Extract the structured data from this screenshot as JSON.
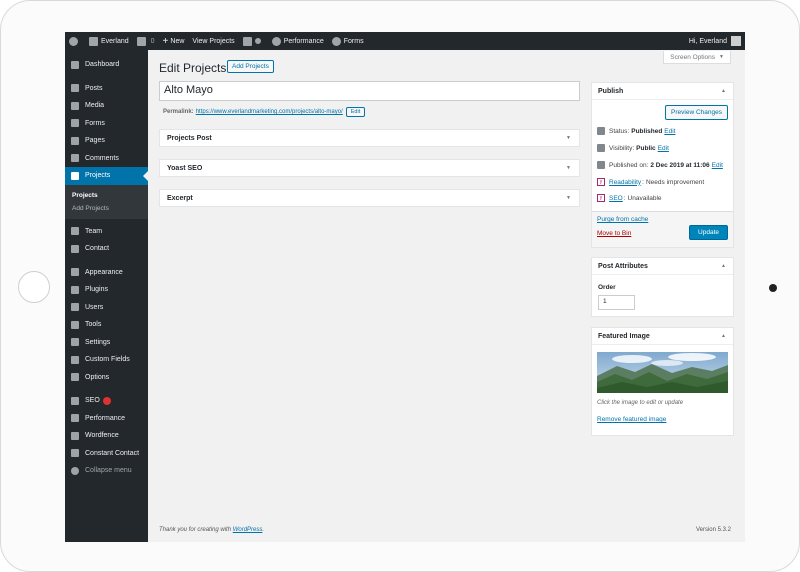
{
  "adminbar": {
    "site_name": "Everland",
    "comments_count": "0",
    "new_label": "New",
    "view_label": "View Projects",
    "performance_label": "Performance",
    "forms_label": "Forms",
    "greeting": "Hi, Everland"
  },
  "sidebar": {
    "items_top": [
      {
        "label": "Dashboard",
        "icon": "dashboard-icon"
      },
      {
        "label": "Posts",
        "icon": "pin-icon"
      },
      {
        "label": "Media",
        "icon": "media-icon"
      },
      {
        "label": "Forms",
        "icon": "forms-icon"
      },
      {
        "label": "Pages",
        "icon": "pages-icon"
      },
      {
        "label": "Comments",
        "icon": "comments-icon"
      }
    ],
    "active": {
      "label": "Projects",
      "icon": "pin-icon"
    },
    "submenu": [
      {
        "label": "Projects"
      },
      {
        "label": "Add Projects"
      }
    ],
    "items_mid": [
      {
        "label": "Team",
        "icon": "pin-icon"
      },
      {
        "label": "Contact",
        "icon": "mail-icon"
      }
    ],
    "items_bottom": [
      {
        "label": "Appearance",
        "icon": "brush-icon"
      },
      {
        "label": "Plugins",
        "icon": "plugin-icon"
      },
      {
        "label": "Users",
        "icon": "users-icon"
      },
      {
        "label": "Tools",
        "icon": "wrench-icon"
      },
      {
        "label": "Settings",
        "icon": "settings-icon"
      },
      {
        "label": "Custom Fields",
        "icon": "fields-icon"
      },
      {
        "label": "Options",
        "icon": "gear-icon"
      }
    ],
    "items_plugins": [
      {
        "label": "SEO",
        "icon": "yoast-icon"
      },
      {
        "label": "Performance",
        "icon": "performance-icon"
      },
      {
        "label": "Wordfence",
        "icon": "wordfence-icon"
      },
      {
        "label": "Constant Contact",
        "icon": "constant-contact-icon"
      }
    ],
    "collapse_label": "Collapse menu"
  },
  "main": {
    "screen_options": "Screen Options",
    "page_title": "Edit Projects",
    "add_button": "Add Projects",
    "post_title": "Alto Mayo",
    "permalink_label": "Permalink:",
    "permalink_url": "https://www.everlandmarketing.com/projects/alto-mayo/",
    "permalink_edit": "Edit",
    "boxes": [
      {
        "label": "Projects Post"
      },
      {
        "label": "Yoast SEO"
      },
      {
        "label": "Excerpt"
      }
    ]
  },
  "publish": {
    "title": "Publish",
    "preview": "Preview Changes",
    "status_label": "Status:",
    "status_value": "Published",
    "visibility_label": "Visibility:",
    "visibility_value": "Public",
    "published_label": "Published on:",
    "published_value": "2 Dec 2019 at 11:06",
    "edit": "Edit",
    "readability_label": "Readability",
    "readability_value": "Needs improvement",
    "seo_label": "SEO",
    "seo_value": "Unavailable",
    "purge": "Purge from cache",
    "trash": "Move to Bin",
    "update": "Update"
  },
  "attributes": {
    "title": "Post Attributes",
    "order_label": "Order",
    "order_value": "1"
  },
  "featured": {
    "title": "Featured Image",
    "caption": "Click the image to edit or update",
    "remove": "Remove featured image"
  },
  "footer": {
    "thanks": "Thank you for creating with",
    "wordpress": "WordPress",
    "version": "Version 5.3.2"
  }
}
